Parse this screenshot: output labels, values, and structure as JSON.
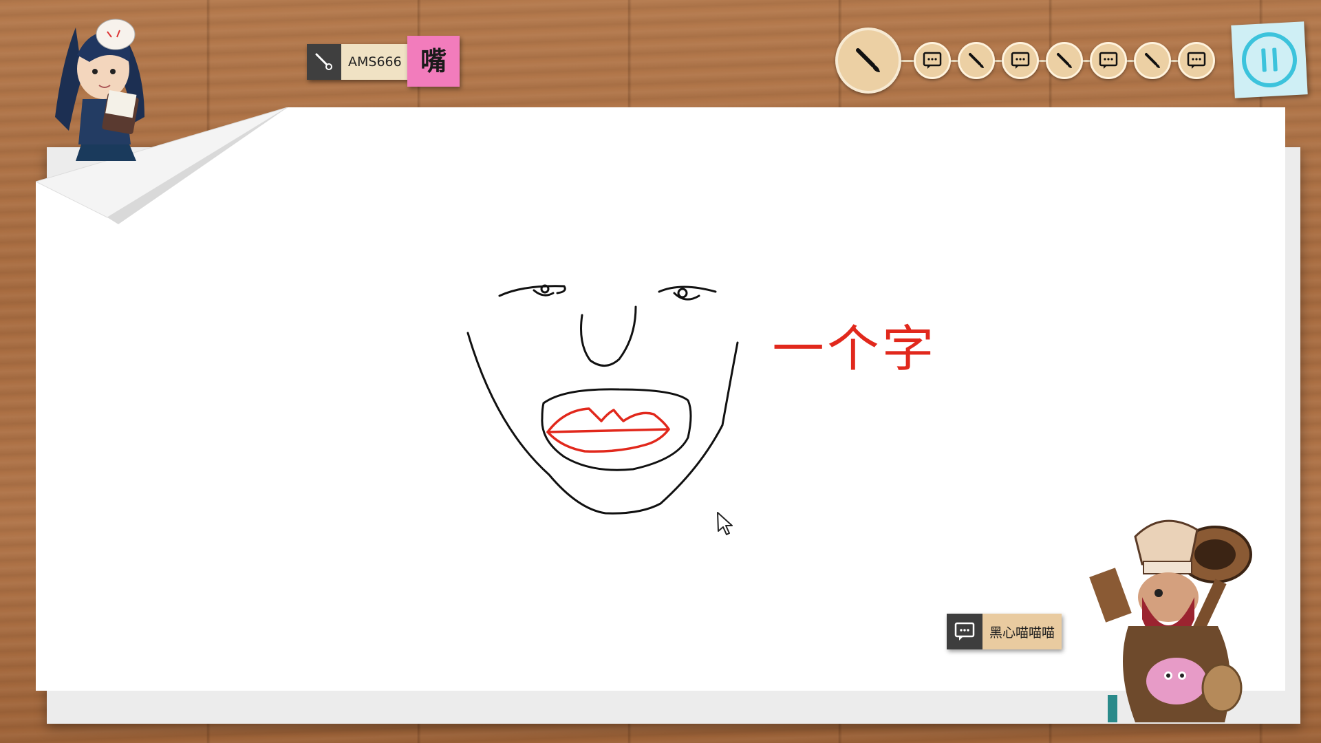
{
  "game": {
    "artist": {
      "name": "AMS666"
    },
    "word_hint": "嘴",
    "canvas": {
      "caption": "一个字"
    },
    "rounds": [
      {
        "type": "draw",
        "current": true
      },
      {
        "type": "guess"
      },
      {
        "type": "draw"
      },
      {
        "type": "guess"
      },
      {
        "type": "draw"
      },
      {
        "type": "guess"
      },
      {
        "type": "draw"
      },
      {
        "type": "guess"
      }
    ],
    "chat": {
      "message": "黑心喵喵喵"
    }
  },
  "icons": {
    "brush": "brush-icon",
    "chat": "chat-bubble-icon",
    "pause": "pause-icon",
    "cursor": "mouse-cursor-icon"
  },
  "colors": {
    "ink_black": "#111111",
    "ink_red": "#e1281c",
    "word_note": "#f27cbc",
    "pause_note": "#cfeff5",
    "pause_ring": "#3cc3dc",
    "round_fill": "#ecd0a4"
  }
}
